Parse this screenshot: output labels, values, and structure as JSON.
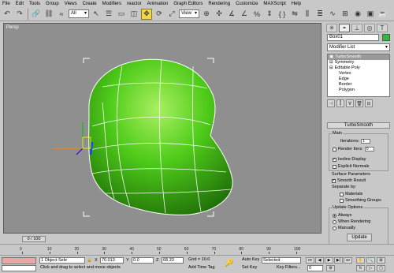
{
  "menu": [
    "File",
    "Edit",
    "Tools",
    "Group",
    "Views",
    "Create",
    "Modifiers",
    "reactor",
    "Animation",
    "Graph Editors",
    "Rendering",
    "Customize",
    "MAXScript",
    "Help"
  ],
  "toolbar": {
    "selection_filter": "All",
    "coord_system": "View",
    "icons": [
      "undo-icon",
      "redo-icon",
      "select-link-icon",
      "unlink-icon",
      "bind-spacewarp-icon",
      "select-icon",
      "select-by-name-icon",
      "region-select-icon",
      "move-icon",
      "rotate-icon",
      "scale-icon",
      "pivot-icon",
      "mirror-icon",
      "align-icon",
      "layers-icon",
      "curve-editor-icon",
      "schematic-icon",
      "material-editor-icon",
      "render-scene-icon",
      "quick-render-icon"
    ]
  },
  "viewport": {
    "label": "Persp"
  },
  "panel": {
    "object_name": "Box01",
    "object_color": "#3bb53b",
    "modifier_list": "Modifier List",
    "stack": [
      {
        "label": "TurboSmooth",
        "selected": true,
        "indent": false
      },
      {
        "label": "Symmetry",
        "selected": false,
        "indent": false
      },
      {
        "label": "Editable Poly",
        "selected": false,
        "indent": false
      },
      {
        "label": "Vertex",
        "selected": false,
        "indent": true
      },
      {
        "label": "Edge",
        "selected": false,
        "indent": true
      },
      {
        "label": "Border",
        "selected": false,
        "indent": true
      },
      {
        "label": "Polygon",
        "selected": false,
        "indent": true
      }
    ],
    "rollout_title": "TurboSmooth",
    "main": {
      "title": "Main",
      "iterations_label": "Iterations:",
      "iterations_value": "1",
      "render_iters_label": "Render Iters:",
      "render_iters_value": "0",
      "isoline_display": "Isoline Display",
      "explicit_normals": "Explicit Normals"
    },
    "surface": {
      "title": "Surface Parameters",
      "smooth_result": "Smooth Result",
      "separate_by": "Separate by:",
      "materials": "Materials",
      "smoothing_groups": "Smoothing Groups"
    },
    "update": {
      "title": "Update Options",
      "always": "Always",
      "when_rendering": "When Rendering",
      "manually": "Manually",
      "update_button": "Update"
    }
  },
  "timeline": {
    "frame_label": "0 / 100",
    "ticks": [
      "0",
      "10",
      "20",
      "30",
      "40",
      "50",
      "60",
      "70",
      "80",
      "90",
      "100"
    ]
  },
  "status": {
    "selection_info": "1 Object Sele",
    "x_value": "70.013",
    "y_value": "0.0",
    "z_value": "68.33",
    "grid": "Grid = 10.0",
    "prompt": "Click and drag to select and move objects",
    "add_time_tag": "Add Time Tag",
    "auto_key": "Auto Key",
    "selected": "Selected",
    "set_key": "Set Key",
    "key_filters": "Key Filters...",
    "frame": "0"
  }
}
